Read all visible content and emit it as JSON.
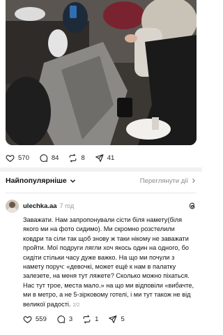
{
  "post": {
    "likes": "570",
    "comments": "84",
    "reposts": "8",
    "shares": "41"
  },
  "sort": {
    "label": "Найпопулярніше",
    "view_activity": "Переглянути дії"
  },
  "comment": {
    "username": "ulechka.aa",
    "time": "7 год",
    "text": "Заважати. Нам запропонували сісти біля намету(біля якого ми на фото сидимо). Ми скромно розстелили ковдри та сіли так щоб знову ж таки нікому не заважати пройти. Мої подруги лягли хоч якось один на одного, бо сидіти стільки часу дуже важко. На що ми почули з намету поруч: «девочкі, может ещё к нам в палатку залезете, на меня тут ляжете? Сколько можно піхаться. Нас тут трое, места мало.» на що ми відповіли «вибачте, ми в метро, а не 5-зірковому готелі, і ми тут також не від великої радості.",
    "page": "2/2",
    "likes": "559",
    "replies": "3",
    "reposts": "1",
    "shares": "5"
  },
  "icons": {
    "like": "heart-icon",
    "comment": "comment-icon",
    "repost": "repost-icon",
    "share": "share-icon",
    "sort": "chevron-down-icon",
    "view": "chevron-right-icon",
    "threads": "threads-logo-icon"
  }
}
